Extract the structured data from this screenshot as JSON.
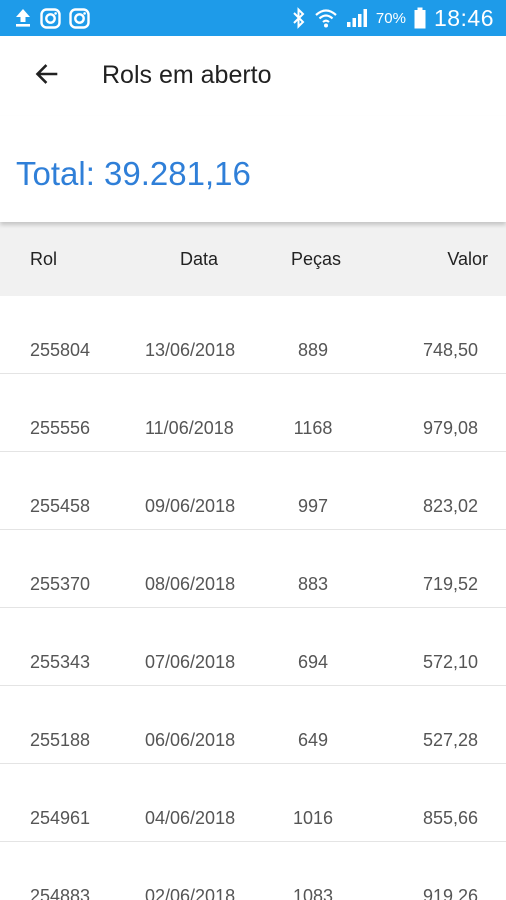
{
  "status_bar": {
    "battery_percent": "70%",
    "time": "18:46",
    "icons": [
      "upload-icon",
      "instagram-icon",
      "instagram-icon",
      "bluetooth-icon",
      "wifi-icon",
      "cellular-signal-icon",
      "battery-icon"
    ]
  },
  "app_bar": {
    "title": "Rols em aberto",
    "back_icon": "arrow-back-icon"
  },
  "summary": {
    "total_text": "Total: 39.281,16"
  },
  "table": {
    "headers": {
      "rol": "Rol",
      "data": "Data",
      "pecas": "Peças",
      "valor": "Valor"
    },
    "rows": [
      {
        "rol": "255804",
        "data": "13/06/2018",
        "pecas": "889",
        "valor": "748,50"
      },
      {
        "rol": "255556",
        "data": "11/06/2018",
        "pecas": "1168",
        "valor": "979,08"
      },
      {
        "rol": "255458",
        "data": "09/06/2018",
        "pecas": "997",
        "valor": "823,02"
      },
      {
        "rol": "255370",
        "data": "08/06/2018",
        "pecas": "883",
        "valor": "719,52"
      },
      {
        "rol": "255343",
        "data": "07/06/2018",
        "pecas": "694",
        "valor": "572,10"
      },
      {
        "rol": "255188",
        "data": "06/06/2018",
        "pecas": "649",
        "valor": "527,28"
      },
      {
        "rol": "254961",
        "data": "04/06/2018",
        "pecas": "1016",
        "valor": "855,66"
      },
      {
        "rol": "254883",
        "data": "02/06/2018",
        "pecas": "1083",
        "valor": "919,26"
      }
    ]
  },
  "colors": {
    "status_bar": "#1e9be9",
    "total_text": "#2f7fd8",
    "header_bg": "#f1f1f1"
  }
}
